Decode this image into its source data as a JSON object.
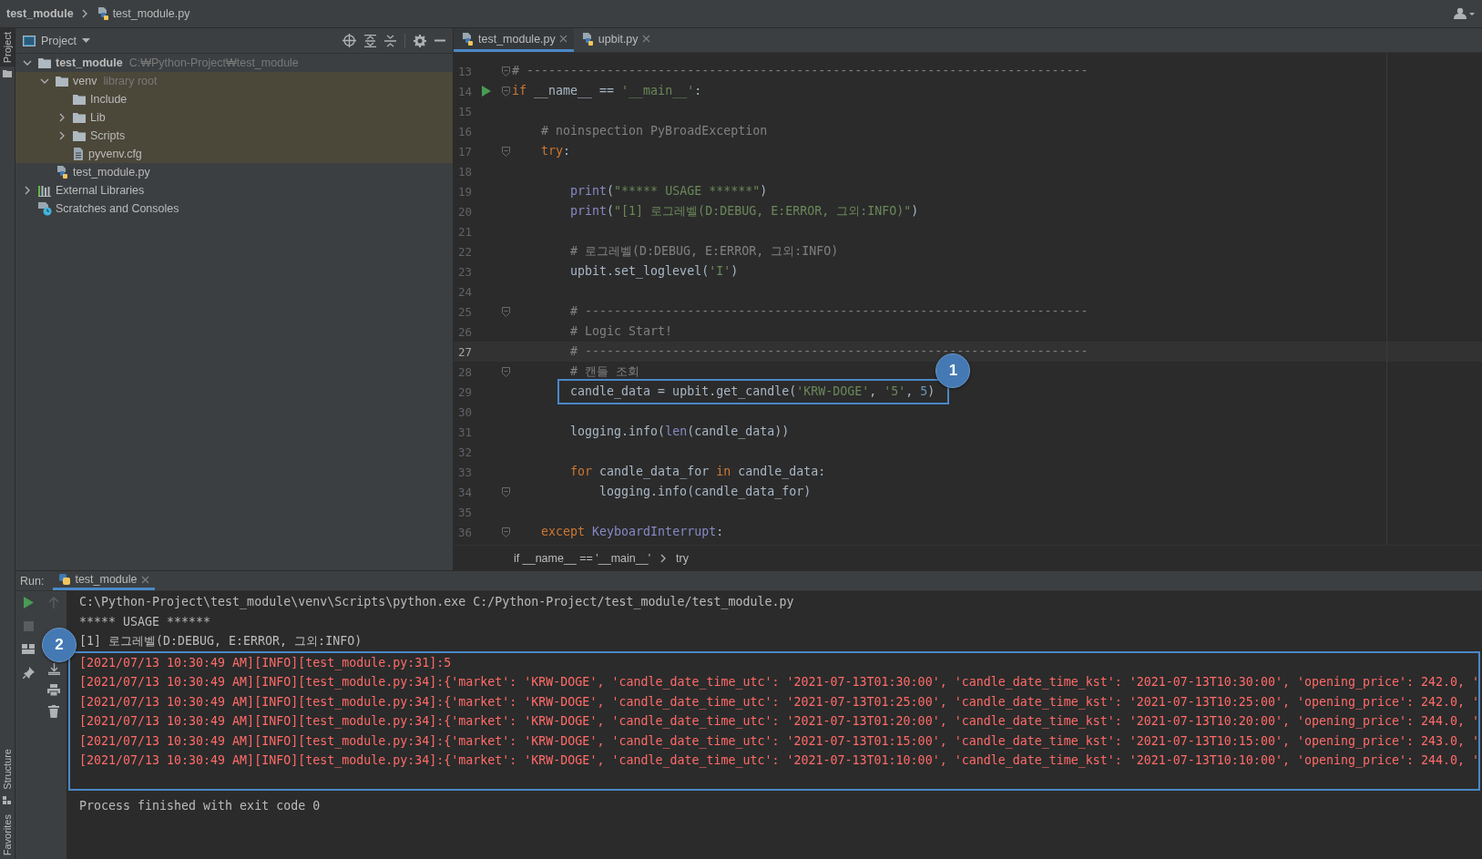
{
  "title_bar": {
    "breadcrumbs": [
      {
        "label": "test_module",
        "kind": "project"
      },
      {
        "label": "test_module.py",
        "kind": "python"
      }
    ]
  },
  "side_stripe": {
    "top": [
      {
        "label": "Project",
        "selected": true
      }
    ],
    "bottom": [
      {
        "label": "Structure",
        "selected": false
      },
      {
        "label": "Favorites",
        "selected": false
      }
    ]
  },
  "project_panel": {
    "title": "Project",
    "tree": [
      {
        "label": "test_module",
        "hint": "C:₩Python-Project₩test_module",
        "kind": "folder",
        "bold": true,
        "expanded": true,
        "highlighted": false,
        "children": [
          {
            "label": "venv",
            "hint": "library root",
            "kind": "folder",
            "bold": false,
            "expanded": true,
            "highlighted": true,
            "children": [
              {
                "label": "Include",
                "kind": "folder",
                "bold": false,
                "highlighted": true
              },
              {
                "label": "Lib",
                "kind": "folder",
                "bold": false,
                "expanded": false,
                "highlighted": true
              },
              {
                "label": "Scripts",
                "kind": "folder",
                "bold": false,
                "expanded": false,
                "highlighted": true
              },
              {
                "label": "pyvenv.cfg",
                "kind": "file",
                "bold": false,
                "highlighted": true
              }
            ]
          },
          {
            "label": "test_module.py",
            "kind": "python",
            "bold": false,
            "highlighted": false
          }
        ]
      },
      {
        "label": "External Libraries",
        "kind": "libraries",
        "bold": false,
        "expanded": false,
        "highlighted": false
      },
      {
        "label": "Scratches and Consoles",
        "kind": "scratches",
        "bold": false,
        "highlighted": false
      }
    ]
  },
  "editor": {
    "tabs": [
      {
        "label": "test_module.py",
        "selected": true
      },
      {
        "label": "upbit.py",
        "selected": false
      }
    ],
    "lines": [
      {
        "number": "13",
        "fold": true,
        "run": false,
        "current": false,
        "boxed": false,
        "tokens": [
          {
            "kind": "comment",
            "text": "# -----------------------------------------------------------------------------"
          }
        ]
      },
      {
        "number": "14",
        "fold": true,
        "run": true,
        "current": false,
        "boxed": false,
        "tokens": [
          {
            "kind": "keyword",
            "text": "if"
          },
          {
            "kind": "plain",
            "text": " __name__ == "
          },
          {
            "kind": "string",
            "text": "'__main__'"
          },
          {
            "kind": "plain",
            "text": ":"
          }
        ]
      },
      {
        "number": "15",
        "fold": false,
        "run": false,
        "current": false,
        "boxed": false
      },
      {
        "number": "16",
        "fold": false,
        "run": false,
        "current": false,
        "boxed": false,
        "tokens": [
          {
            "kind": "comment",
            "text": "    # noinspection PyBroadException"
          }
        ]
      },
      {
        "number": "17",
        "fold": true,
        "run": false,
        "current": false,
        "boxed": false,
        "tokens": [
          {
            "kind": "keyword",
            "text": "    try"
          },
          {
            "kind": "plain",
            "text": ":"
          }
        ]
      },
      {
        "number": "18",
        "fold": false,
        "run": false,
        "current": false,
        "boxed": false
      },
      {
        "number": "19",
        "fold": false,
        "run": false,
        "current": false,
        "boxed": false,
        "tokens": [
          {
            "kind": "builtin",
            "text": "        print"
          },
          {
            "kind": "plain",
            "text": "("
          },
          {
            "kind": "string",
            "text": "\"***** USAGE ******\""
          },
          {
            "kind": "plain",
            "text": ")"
          }
        ]
      },
      {
        "number": "20",
        "fold": false,
        "run": false,
        "current": false,
        "boxed": false,
        "tokens": [
          {
            "kind": "builtin",
            "text": "        print"
          },
          {
            "kind": "plain",
            "text": "("
          },
          {
            "kind": "string",
            "text": "\"[1] 로그레벨(D:DEBUG, E:ERROR, 그외:INFO)\""
          },
          {
            "kind": "plain",
            "text": ")"
          }
        ]
      },
      {
        "number": "21",
        "fold": false,
        "run": false,
        "current": false,
        "boxed": false
      },
      {
        "number": "22",
        "fold": false,
        "run": false,
        "current": false,
        "boxed": false,
        "tokens": [
          {
            "kind": "comment",
            "text": "        # 로그레벨(D:DEBUG, E:ERROR, 그외:INFO)"
          }
        ]
      },
      {
        "number": "23",
        "fold": false,
        "run": false,
        "current": false,
        "boxed": false,
        "tokens": [
          {
            "kind": "plain",
            "text": "        upbit.set_loglevel("
          },
          {
            "kind": "string",
            "text": "'I'"
          },
          {
            "kind": "plain",
            "text": ")"
          }
        ]
      },
      {
        "number": "24",
        "fold": false,
        "run": false,
        "current": false,
        "boxed": false
      },
      {
        "number": "25",
        "fold": true,
        "run": false,
        "current": false,
        "boxed": false,
        "tokens": [
          {
            "kind": "comment",
            "text": "        # ---------------------------------------------------------------------"
          }
        ]
      },
      {
        "number": "26",
        "fold": false,
        "run": false,
        "current": false,
        "boxed": false,
        "tokens": [
          {
            "kind": "comment",
            "text": "        # Logic Start!"
          }
        ]
      },
      {
        "number": "27",
        "fold": false,
        "run": false,
        "current": true,
        "boxed": false,
        "tokens": [
          {
            "kind": "comment",
            "text": "        # ---------------------------------------------------------------------"
          }
        ]
      },
      {
        "number": "28",
        "fold": true,
        "run": false,
        "current": false,
        "boxed": false,
        "tokens": [
          {
            "kind": "comment",
            "text": "        # 캔들 조회"
          }
        ]
      },
      {
        "number": "29",
        "fold": false,
        "run": false,
        "current": false,
        "boxed": true,
        "tokens": [
          {
            "kind": "plain",
            "text": "candle_data = upbit.get_candle("
          },
          {
            "kind": "string",
            "text": "'KRW-DOGE'"
          },
          {
            "kind": "plain",
            "text": ", "
          },
          {
            "kind": "string",
            "text": "'5'"
          },
          {
            "kind": "plain",
            "text": ", "
          },
          {
            "kind": "number",
            "text": "5"
          },
          {
            "kind": "plain",
            "text": ")"
          }
        ]
      },
      {
        "number": "30",
        "fold": false,
        "run": false,
        "current": false,
        "boxed": false
      },
      {
        "number": "31",
        "fold": false,
        "run": false,
        "current": false,
        "boxed": false,
        "tokens": [
          {
            "kind": "plain",
            "text": "        logging.info("
          },
          {
            "kind": "builtin",
            "text": "len"
          },
          {
            "kind": "plain",
            "text": "(candle_data))"
          }
        ]
      },
      {
        "number": "32",
        "fold": false,
        "run": false,
        "current": false,
        "boxed": false
      },
      {
        "number": "33",
        "fold": false,
        "run": false,
        "current": false,
        "boxed": false,
        "tokens": [
          {
            "kind": "keyword",
            "text": "        for"
          },
          {
            "kind": "plain",
            "text": " candle_data_for "
          },
          {
            "kind": "keyword",
            "text": "in"
          },
          {
            "kind": "plain",
            "text": " candle_data:"
          }
        ]
      },
      {
        "number": "34",
        "fold": true,
        "run": false,
        "current": false,
        "boxed": false,
        "tokens": [
          {
            "kind": "plain",
            "text": "            logging.info(candle_data_for)"
          }
        ]
      },
      {
        "number": "35",
        "fold": false,
        "run": false,
        "current": false,
        "boxed": false
      },
      {
        "number": "36",
        "fold": true,
        "run": false,
        "current": false,
        "boxed": false,
        "tokens": [
          {
            "kind": "keyword",
            "text": "    except"
          },
          {
            "kind": "class",
            "text": " KeyboardInterrupt"
          },
          {
            "kind": "plain",
            "text": ":"
          }
        ]
      }
    ],
    "callout": "1",
    "breadcrumbs": [
      "if __name__ == '__main__'",
      "try"
    ]
  },
  "run_panel": {
    "label": "Run:",
    "tabs": [
      {
        "label": "test_module",
        "selected": true
      }
    ],
    "console": {
      "callout": "2",
      "lines": [
        {
          "kind": "plain",
          "boxed": false,
          "text": "C:\\Python-Project\\test_module\\venv\\Scripts\\python.exe C:/Python-Project/test_module/test_module.py"
        },
        {
          "kind": "plain",
          "boxed": false,
          "text": "***** USAGE ******"
        },
        {
          "kind": "plain",
          "boxed": false,
          "text": "[1] 로그레벨(D:DEBUG, E:ERROR, 그외:INFO)"
        },
        {
          "kind": "error",
          "boxed": true,
          "text": "[2021/07/13 10:30:49 AM][INFO][test_module.py:31]:5"
        },
        {
          "kind": "error",
          "boxed": true,
          "text": "[2021/07/13 10:30:49 AM][INFO][test_module.py:34]:{'market': 'KRW-DOGE', 'candle_date_time_utc': '2021-07-13T01:30:00', 'candle_date_time_kst': '2021-07-13T10:30:00', 'opening_price': 242.0, '"
        },
        {
          "kind": "error",
          "boxed": true,
          "text": "[2021/07/13 10:30:49 AM][INFO][test_module.py:34]:{'market': 'KRW-DOGE', 'candle_date_time_utc': '2021-07-13T01:25:00', 'candle_date_time_kst': '2021-07-13T10:25:00', 'opening_price': 242.0, '"
        },
        {
          "kind": "error",
          "boxed": true,
          "text": "[2021/07/13 10:30:49 AM][INFO][test_module.py:34]:{'market': 'KRW-DOGE', 'candle_date_time_utc': '2021-07-13T01:20:00', 'candle_date_time_kst': '2021-07-13T10:20:00', 'opening_price': 244.0, '"
        },
        {
          "kind": "error",
          "boxed": true,
          "text": "[2021/07/13 10:30:49 AM][INFO][test_module.py:34]:{'market': 'KRW-DOGE', 'candle_date_time_utc': '2021-07-13T01:15:00', 'candle_date_time_kst': '2021-07-13T10:15:00', 'opening_price': 243.0, '"
        },
        {
          "kind": "error",
          "boxed": true,
          "text": "[2021/07/13 10:30:49 AM][INFO][test_module.py:34]:{'market': 'KRW-DOGE', 'candle_date_time_utc': '2021-07-13T01:10:00', 'candle_date_time_kst': '2021-07-13T10:10:00', 'opening_price': 244.0, '"
        },
        {
          "kind": "plain",
          "boxed": false,
          "text": "Process finished with exit code 0"
        }
      ]
    }
  }
}
